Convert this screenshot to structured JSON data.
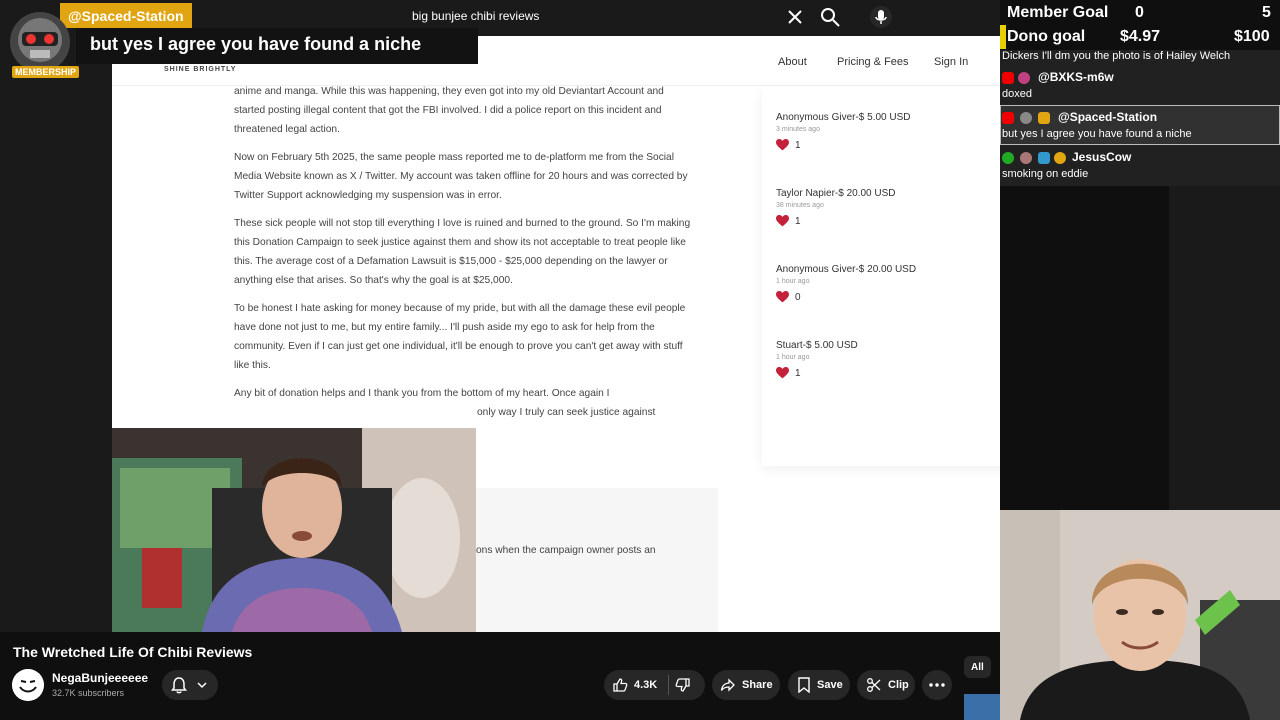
{
  "search": {
    "query": "big bunjee chibi reviews"
  },
  "highlight": {
    "user": "@Spaced-Station",
    "message": "but yes I agree you have found a niche",
    "badge": "MEMBERSHIP"
  },
  "site": {
    "logo_tagline": "SHINE BRIGHTLY",
    "nav": [
      "About",
      "Pricing & Fees",
      "Sign In"
    ],
    "paragraphs": [
      "anime and manga. While this was happening, they even got into my old Deviantart Account and started posting illegal content that got the FBI involved. I did a police report on this incident and threatened legal action.",
      "Now on February 5th 2025, the same people mass reported me to de-platform me from the Social Media Website known as X / Twitter. My account was taken offline for 20 hours and was corrected by Twitter Support acknowledging my suspension was in error.",
      "These sick people will not stop till everything I love is ruined and burned to the ground. So I'm making this Donation Campaign to seek justice against them and show its not acceptable to treat people like this. The average cost of a Defamation Lawsuit is $15,000 - $25,000 depending on the lawyer or anything else that arises. So that's why the goal is at $25,000.",
      "To be honest I hate asking for money because of my pride, but with all the damage these evil people have done not just to me, but my entire family... I'll push aside my ego to ask for help from the community. Even if I can just get one individual, it'll be enough to prove you can't get away with stuff like this.",
      "Any bit of donation helps and I thank you from the bottom of my heart. Once again I"
    ],
    "paragraph_tail": "only way I truly can seek justice against",
    "lower_text": "ons when the campaign owner posts an",
    "donations": [
      {
        "name": "Anonymous Giver-$ 5.00 USD",
        "time": "3 minutes ago",
        "likes": "1"
      },
      {
        "name": "Taylor Napier-$ 20.00 USD",
        "time": "38 minutes ago",
        "likes": "1"
      },
      {
        "name": "Anonymous Giver-$ 20.00 USD",
        "time": "1 hour ago",
        "likes": "0"
      },
      {
        "name": "Stuart-$ 5.00 USD",
        "time": "1 hour ago",
        "likes": "1"
      }
    ]
  },
  "goals": {
    "member_label": "Member Goal",
    "member_current": "0",
    "member_target": "5",
    "dono_label": "Dono goal",
    "dono_current": "$4.97",
    "dono_target": "$100"
  },
  "chat": [
    {
      "user": "",
      "message": "Dickers I'll dm you the photo is of Hailey Welch"
    },
    {
      "user": "@BXKS-m6w",
      "message": "doxed"
    },
    {
      "user": "@Spaced-Station",
      "message": "but yes I agree you have found a niche"
    },
    {
      "user": "JesusCow",
      "message": "smoking on eddie"
    }
  ],
  "video": {
    "title": "The Wretched Life Of Chibi Reviews",
    "channel": "NegaBunjeeeeee",
    "subscribers": "32.7K subscribers",
    "likes": "4.3K",
    "share": "Share",
    "save": "Save",
    "clip": "Clip",
    "chip_all": "All"
  },
  "colors": {
    "accent_gold": "#e1a512",
    "heart_red": "#c4213b",
    "yt_dark": "#0f0f0f"
  }
}
